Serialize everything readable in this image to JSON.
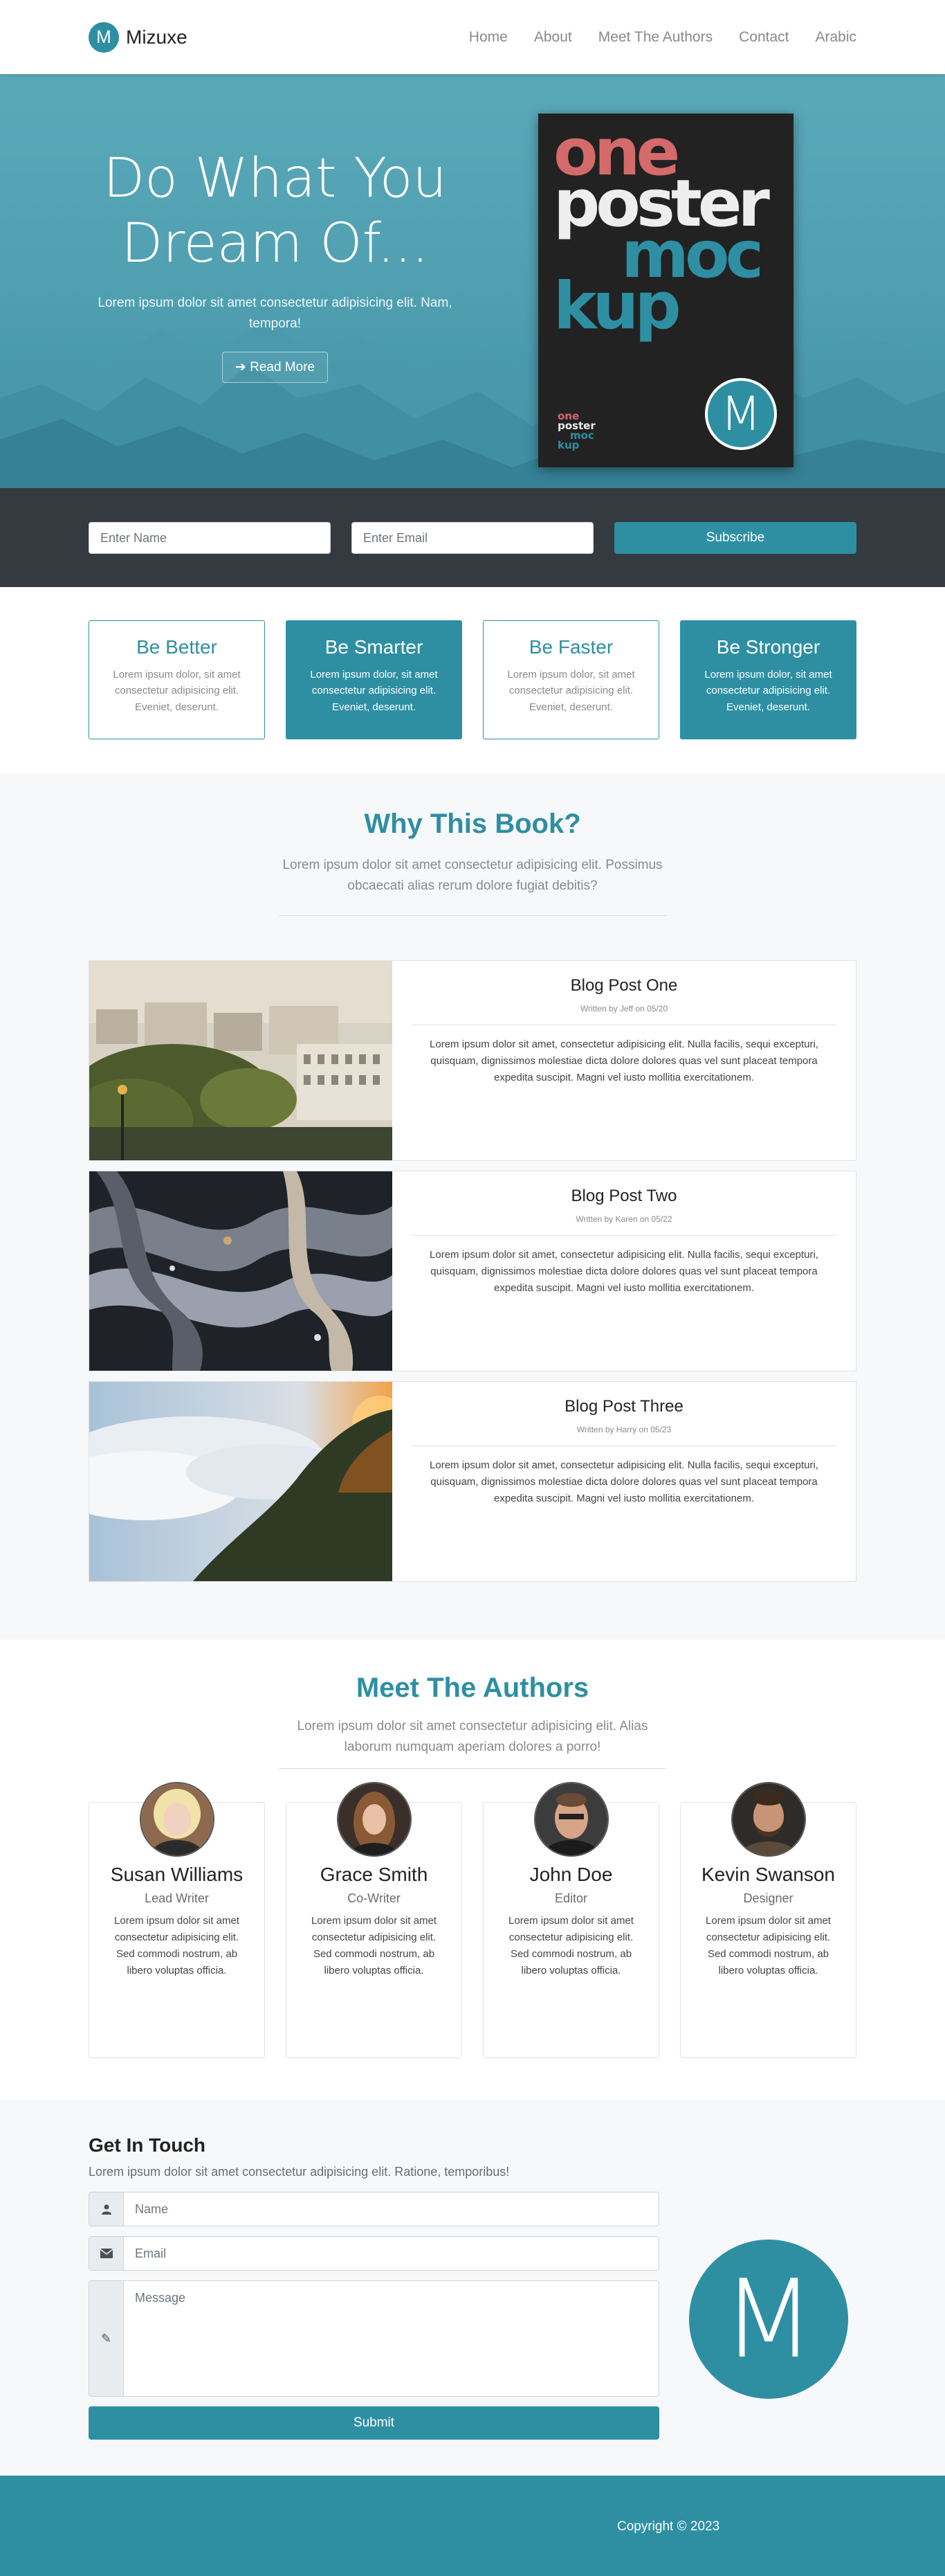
{
  "nav": {
    "brand_initial": "M",
    "brand_name": "Mizuxe",
    "links": [
      "Home",
      "About",
      "Meet The Authors",
      "Contact",
      "Arabic"
    ]
  },
  "hero": {
    "title_line1": "Do What You",
    "title_line2": "Dream Of...",
    "subtitle": "Lorem ipsum dolor sit amet consectetur adipisicing elit. Nam, tempora!",
    "button_label": "Read More",
    "poster": {
      "lines": [
        "one",
        "poster",
        "moc",
        "kup"
      ],
      "small_lines": [
        "one",
        "poster",
        "moc",
        "kup"
      ],
      "badge": "M"
    }
  },
  "subscribe": {
    "name_placeholder": "Enter Name",
    "email_placeholder": "Enter Email",
    "button_label": "Subscribe"
  },
  "features": [
    {
      "title": "Be Better",
      "text": "Lorem ipsum dolor, sit amet consectetur adipisicing elit. Eveniet, deserunt."
    },
    {
      "title": "Be Smarter",
      "text": "Lorem ipsum dolor, sit amet consectetur adipisicing elit. Eveniet, deserunt."
    },
    {
      "title": "Be Faster",
      "text": "Lorem ipsum dolor, sit amet consectetur adipisicing elit. Eveniet, deserunt."
    },
    {
      "title": "Be Stronger",
      "text": "Lorem ipsum dolor, sit amet consectetur adipisicing elit. Eveniet, deserunt."
    }
  ],
  "why": {
    "title": "Why This Book?",
    "subtitle": "Lorem ipsum dolor sit amet consectetur adipisicing elit. Possimus obcaecati alias rerum dolore fugiat debitis?",
    "posts": [
      {
        "title": "Blog Post One",
        "meta": "Written by Jeff on 05/20",
        "text": "Lorem ipsum dolor sit amet, consectetur adipisicing elit. Nulla facilis, sequi excepturi, quisquam, dignissimos molestiae dicta dolore dolores quas vel sunt placeat tempora expedita suscipit. Magni vel iusto mollitia exercitationem."
      },
      {
        "title": "Blog Post Two",
        "meta": "Written by Karen on 05/22",
        "text": "Lorem ipsum dolor sit amet, consectetur adipisicing elit. Nulla facilis, sequi excepturi, quisquam, dignissimos molestiae dicta dolore dolores quas vel sunt placeat tempora expedita suscipit. Magni vel iusto mollitia exercitationem."
      },
      {
        "title": "Blog Post Three",
        "meta": "Written by Harry on 05/23",
        "text": "Lorem ipsum dolor sit amet, consectetur adipisicing elit. Nulla facilis, sequi excepturi, quisquam, dignissimos molestiae dicta dolore dolores quas vel sunt placeat tempora expedita suscipit. Magni vel iusto mollitia exercitationem."
      }
    ]
  },
  "authors": {
    "title": "Meet The Authors",
    "subtitle": "Lorem ipsum dolor sit amet consectetur adipisicing elit. Alias laborum numquam aperiam dolores a porro!",
    "people": [
      {
        "name": "Susan Williams",
        "role": "Lead Writer",
        "bio": "Lorem ipsum dolor sit amet consectetur adipisicing elit. Sed commodi nostrum, ab libero voluptas officia."
      },
      {
        "name": "Grace Smith",
        "role": "Co-Writer",
        "bio": "Lorem ipsum dolor sit amet consectetur adipisicing elit. Sed commodi nostrum, ab libero voluptas officia."
      },
      {
        "name": "John Doe",
        "role": "Editor",
        "bio": "Lorem ipsum dolor sit amet consectetur adipisicing elit. Sed commodi nostrum, ab libero voluptas officia."
      },
      {
        "name": "Kevin Swanson",
        "role": "Designer",
        "bio": "Lorem ipsum dolor sit amet consectetur adipisicing elit. Sed commodi nostrum, ab libero voluptas officia."
      }
    ]
  },
  "contact": {
    "title": "Get In Touch",
    "subtitle": "Lorem ipsum dolor sit amet consectetur adipisicing elit. Ratione, temporibus!",
    "name_placeholder": "Name",
    "email_placeholder": "Email",
    "message_placeholder": "Message",
    "submit_label": "Submit",
    "logo_letter": "M"
  },
  "footer": {
    "copyright": "Copyright © 2023"
  },
  "colors": {
    "accent": "#2e8fa3",
    "dark": "#343a40",
    "light_bg": "#f7f8fa"
  },
  "icons": {
    "read_more": "arrow-right-icon",
    "name": "user-icon",
    "email": "envelope-icon",
    "message": "pencil-icon"
  }
}
